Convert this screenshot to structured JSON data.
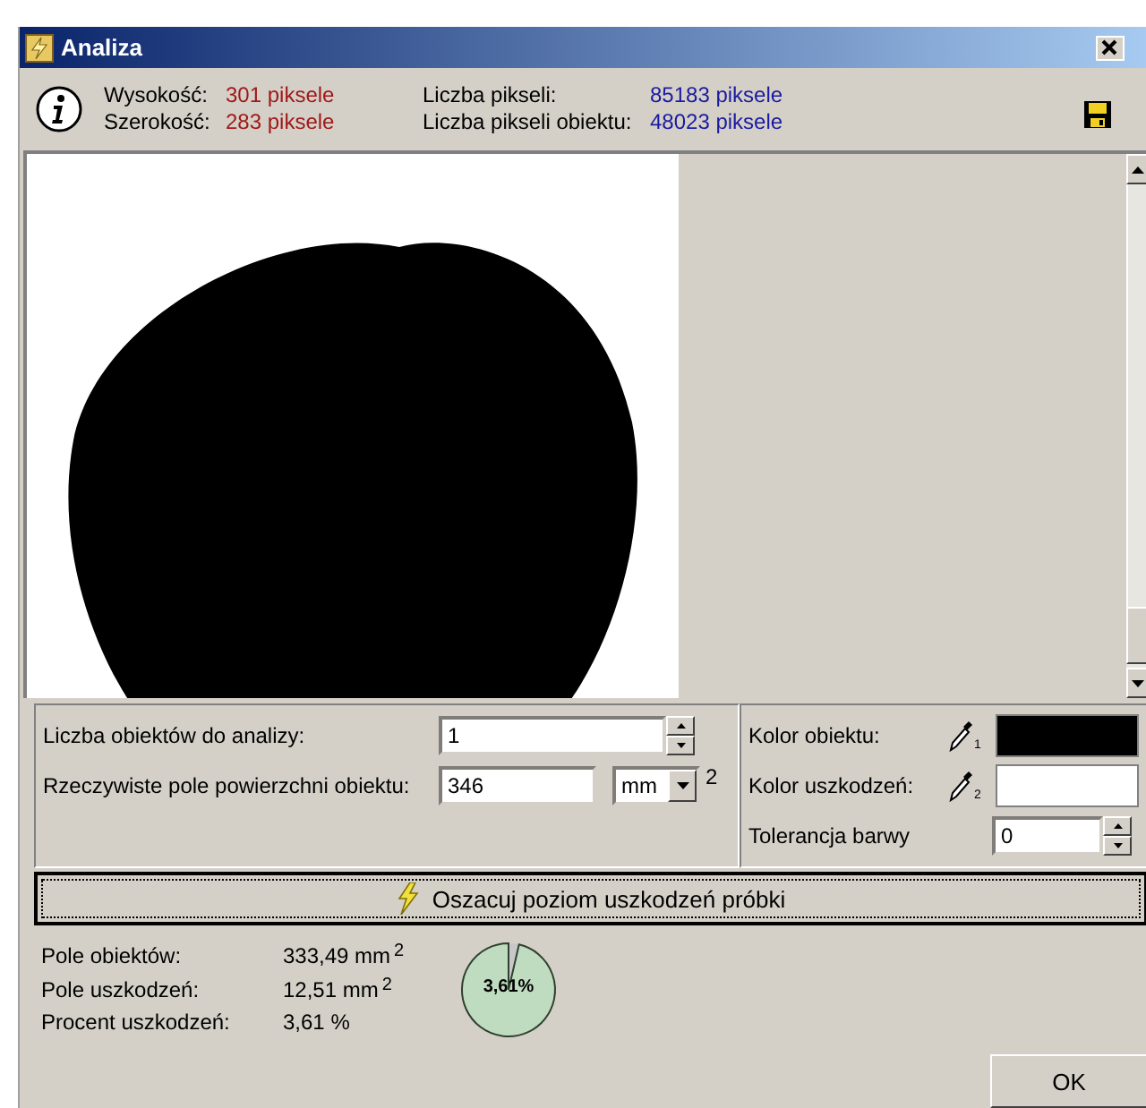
{
  "window": {
    "title": "Analiza"
  },
  "info": [
    {
      "label": "Wysokość:",
      "value": "301 piksele",
      "kind": "dimension"
    },
    {
      "label": "Szerokość:",
      "value": "283 piksele",
      "kind": "dimension"
    },
    {
      "label": "Liczba pikseli:",
      "value": "85183 piksele",
      "kind": "count"
    },
    {
      "label": "Liczba pikseli obiektu:",
      "value": "48023 piksele",
      "kind": "count"
    }
  ],
  "settings": {
    "object_count": {
      "label": "Liczba obiektów do analizy:",
      "value": "1"
    },
    "area": {
      "label": "Rzeczywiste pole powierzchni obiektu:",
      "value": "346",
      "unit": "mm",
      "unit_exponent": "2"
    }
  },
  "colors": [
    {
      "label": "Kolor obiektu:",
      "picker": "1",
      "color": "#000000"
    },
    {
      "label": "Kolor uszkodzeń:",
      "picker": "2",
      "color": "#ffffff"
    }
  ],
  "tolerance": {
    "label": "Tolerancja barwy",
    "value": "0"
  },
  "analyze_button": "Oszacuj poziom uszkodzeń próbki",
  "results": [
    {
      "label": "Pole obiektów:",
      "value": "333,49 mm$^{2}$"
    },
    {
      "label": "Pole uszkodzeń:",
      "value": "12,51 mm$^{2}$"
    },
    {
      "label": "Procent uszkodzeń:",
      "value": "3,61 %"
    }
  ],
  "gauge": {
    "label": "3,61%",
    "chart_data": {
      "type": "pie",
      "values": [
        3.61,
        96.39
      ]
    }
  },
  "ok_button": "OK"
}
